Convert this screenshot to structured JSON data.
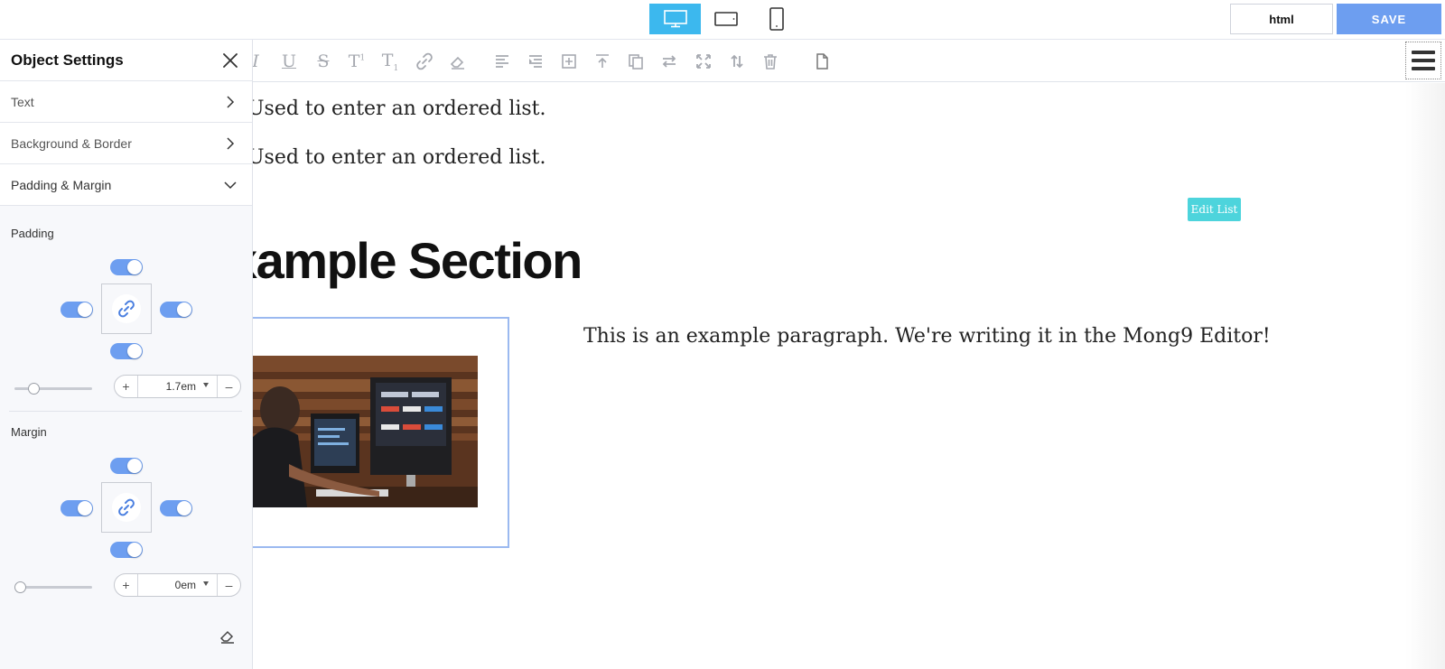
{
  "topbar": {
    "devices": [
      {
        "name": "desktop",
        "icon": "desktop-icon",
        "active": true
      },
      {
        "name": "tablet",
        "icon": "tablet-landscape-icon",
        "active": false
      },
      {
        "name": "mobile",
        "icon": "mobile-icon",
        "active": false
      }
    ],
    "html_label": "html",
    "save_label": "SAVE"
  },
  "toolbar": {
    "icons": [
      "italic-icon",
      "underline-icon",
      "strikethrough-icon",
      "superscript-icon",
      "subscript-icon",
      "link-icon",
      "eraser-icon",
      "align-left-icon",
      "indent-icon",
      "add-block-icon",
      "insert-above-icon",
      "copy-icon",
      "swap-icon",
      "expand-icon",
      "move-vertical-icon",
      "trash-icon",
      "file-icon"
    ]
  },
  "panel": {
    "title": "Object Settings",
    "sections": [
      {
        "label": "Text",
        "state": "collapsed"
      },
      {
        "label": "Background & Border",
        "state": "collapsed"
      },
      {
        "label": "Padding & Margin",
        "state": "expanded"
      }
    ],
    "padding": {
      "label": "Padding",
      "value": "1.7em",
      "slider_fraction": 0.25
    },
    "margin": {
      "label": "Margin",
      "value": "0em",
      "slider_fraction": 0.0
    }
  },
  "canvas": {
    "list_items": [
      "Used to enter an ordered list.",
      "Used to enter an ordered list."
    ],
    "edit_list_label": "Edit List",
    "section_title": "xample Section",
    "paragraph": "This is an example paragraph. We're writing it in the Mong9 Editor!"
  },
  "colors": {
    "accent_blue": "#6d9ef0",
    "device_active": "#3cb8ee",
    "edit_list_bg": "#4dd4dc"
  }
}
